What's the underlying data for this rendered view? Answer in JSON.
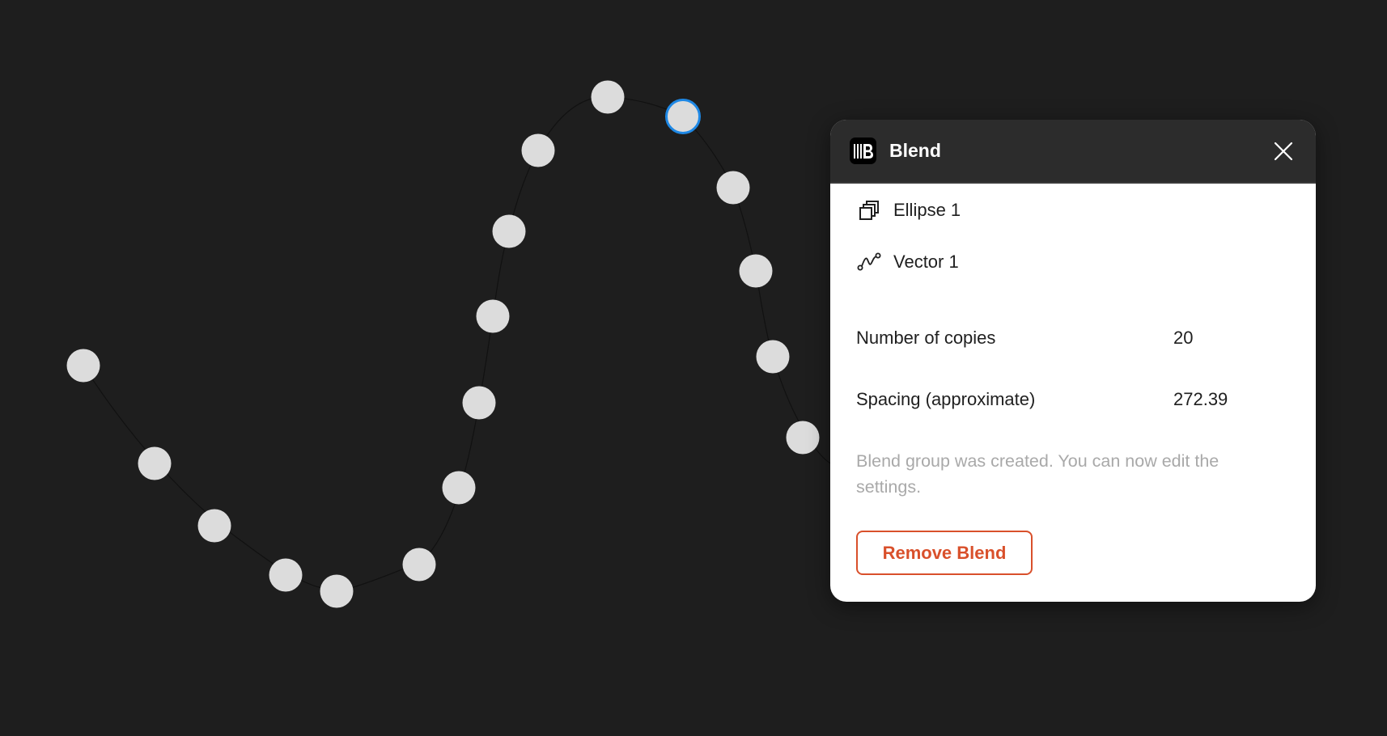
{
  "panel": {
    "title": "Blend",
    "logo_icon": "blend-logo-icon",
    "close_icon": "close-icon",
    "layers": [
      {
        "label": "Ellipse 1",
        "icon": "copies-icon"
      },
      {
        "label": "Vector 1",
        "icon": "path-icon"
      }
    ],
    "properties": {
      "copies": {
        "label": "Number of copies",
        "value": "20"
      },
      "spacing": {
        "label": "Spacing (approximate)",
        "value": "272.39"
      }
    },
    "status": "Blend group was created. You can now edit the settings.",
    "remove_button": "Remove Blend"
  },
  "canvas": {
    "background": "#1e1e1e",
    "dot_color": "#dcdcdc",
    "selected_color": "#1e88e5",
    "accent_remove": "#d9502b"
  }
}
